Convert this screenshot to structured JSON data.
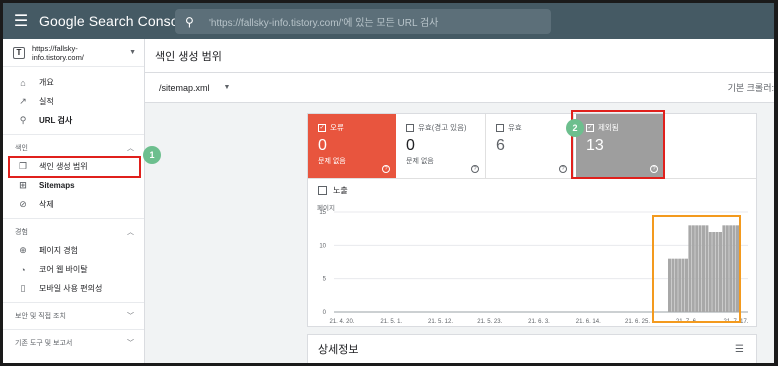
{
  "app": {
    "brand": "Google Search Console"
  },
  "search": {
    "placeholder": "'https://fallsky-info.tistory.com/'에 있는 모든 URL 검사"
  },
  "property": {
    "name": "https://fallsky-info.tistory.com/",
    "icon_letter": "T"
  },
  "sidebar": {
    "top_items": [
      {
        "label": "개요",
        "icon": "home-icon"
      },
      {
        "label": "실적",
        "icon": "trending-icon"
      },
      {
        "label": "URL 검사",
        "icon": "search-icon"
      }
    ],
    "index_section": "색인",
    "index_items": [
      {
        "label": "색인 생성 범위",
        "icon": "coverage-icon"
      },
      {
        "label": "Sitemaps",
        "icon": "sitemap-icon"
      },
      {
        "label": "삭제",
        "icon": "removal-icon"
      }
    ],
    "experience_section": "경험",
    "experience_items": [
      {
        "label": "페이지 경험",
        "icon": "page-experience-icon"
      },
      {
        "label": "코어 웹 바이탈",
        "icon": "speed-icon"
      },
      {
        "label": "모바일 사용 편의성",
        "icon": "phone-icon"
      }
    ],
    "security_section": "보안 및 직접 조치",
    "legacy_section": "기존 도구 및 보고서"
  },
  "page": {
    "title": "색인 생성 범위"
  },
  "sitemap_bar": {
    "selected": "/sitemap.xml",
    "right_text": "기본 크롤러:"
  },
  "tiles": [
    {
      "label": "오류",
      "value": "0",
      "sub": "문제 없음",
      "checked": true
    },
    {
      "label": "유효(경고 있음)",
      "value": "0",
      "sub": "문제 없음",
      "checked": false
    },
    {
      "label": "유효",
      "value": "6",
      "sub": "",
      "checked": false
    },
    {
      "label": "제외됨",
      "value": "13",
      "sub": "",
      "checked": true
    }
  ],
  "impressions_label": "노출",
  "annotations": {
    "badge1": "1",
    "badge2": "2"
  },
  "colors": {
    "error": "#e8553e",
    "excluded": "#9e9e9e",
    "topbar": "#455a64",
    "highlight": "#e0201c",
    "orange_box": "#f39a1e",
    "badge": "#6dbf8e"
  },
  "chart_data": {
    "type": "bar",
    "ylabel": "페이지",
    "y_ticks": [
      "15",
      "10",
      "5",
      "0"
    ],
    "ylim": [
      0,
      15
    ],
    "x_tick_labels": [
      "21. 4. 20.",
      "21. 5. 1.",
      "21. 5. 12.",
      "21. 5. 23.",
      "21. 6. 3.",
      "21. 6. 14.",
      "21. 6. 25.",
      "21. 7. 6.",
      "21. 7. 17."
    ],
    "series": [
      {
        "values": [
          8,
          8,
          8,
          8,
          8,
          8,
          13,
          13,
          13,
          13,
          13,
          13,
          12,
          12,
          12,
          12,
          13,
          13,
          13,
          13,
          13
        ]
      }
    ]
  },
  "details": {
    "title": "상세정보"
  }
}
